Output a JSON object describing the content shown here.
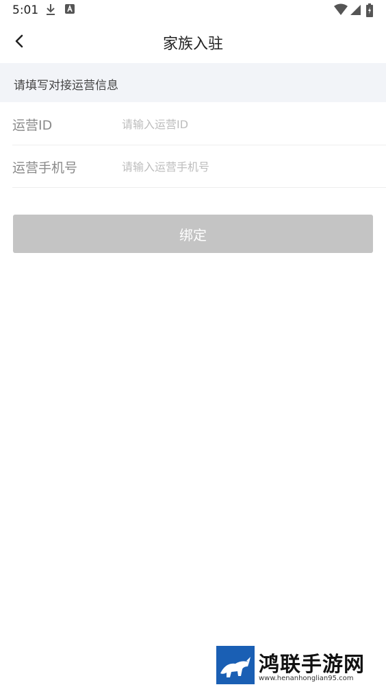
{
  "status_bar": {
    "time": "5:01",
    "icons": [
      "download-icon",
      "text-icon",
      "wifi-icon",
      "signal-icon",
      "battery-icon"
    ]
  },
  "nav": {
    "title": "家族入驻",
    "back_icon": "chevron-left-icon"
  },
  "section": {
    "header": "请填写对接运营信息"
  },
  "form": {
    "operator_id": {
      "label": "运营ID",
      "placeholder": "请输入运营ID",
      "value": ""
    },
    "operator_phone": {
      "label": "运营手机号",
      "placeholder": "请输入运营手机号",
      "value": ""
    }
  },
  "actions": {
    "bind_label": "绑定",
    "bind_color": "#c4c4c4"
  },
  "watermark": {
    "title": "鸿联手游网",
    "url": "www.henanhonglian95.com"
  }
}
